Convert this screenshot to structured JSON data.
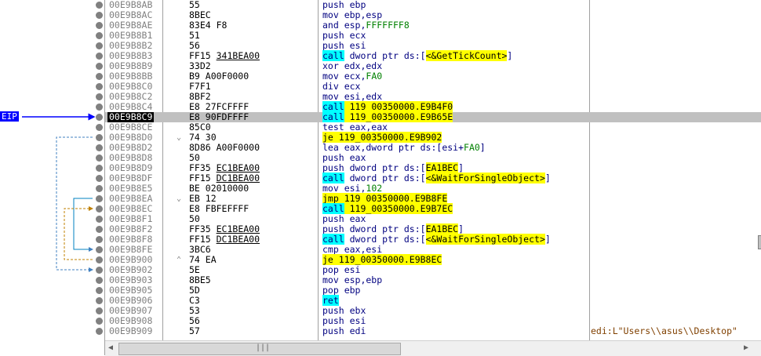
{
  "eip_label": "EIP",
  "colors": {
    "eip_bg": "#0000ff",
    "highlight_call": "#00ffff",
    "highlight_jump": "#ffff00"
  },
  "rows": [
    {
      "addr": "00E9B8AB",
      "arrow": "",
      "bytes": "55",
      "bytes_ul": "",
      "instr": [
        [
          "",
          "push ebp"
        ]
      ],
      "comment": ""
    },
    {
      "addr": "00E9B8AC",
      "arrow": "",
      "bytes": "8BEC",
      "bytes_ul": "",
      "instr": [
        [
          "",
          "mov ebp,esp"
        ]
      ],
      "comment": ""
    },
    {
      "addr": "00E9B8AE",
      "arrow": "",
      "bytes": "83E4 F8",
      "bytes_ul": "",
      "instr": [
        [
          "",
          "and esp,"
        ],
        [
          "num",
          "FFFFFFF8"
        ]
      ],
      "comment": ""
    },
    {
      "addr": "00E9B8B1",
      "arrow": "",
      "bytes": "51",
      "bytes_ul": "",
      "instr": [
        [
          "",
          "push ecx"
        ]
      ],
      "comment": ""
    },
    {
      "addr": "00E9B8B2",
      "arrow": "",
      "bytes": "56",
      "bytes_ul": "",
      "instr": [
        [
          "",
          "push esi"
        ]
      ],
      "comment": ""
    },
    {
      "addr": "00E9B8B3",
      "arrow": "",
      "bytes": "FF15 ",
      "bytes_ul": "341BEA00",
      "instr": [
        [
          "cyan",
          "call"
        ],
        [
          "",
          " dword ptr ds:["
        ],
        [
          "yellow",
          "<&GetTickCount>"
        ],
        [
          "",
          "]"
        ]
      ],
      "comment": ""
    },
    {
      "addr": "00E9B8B9",
      "arrow": "",
      "bytes": "33D2",
      "bytes_ul": "",
      "instr": [
        [
          "",
          "xor edx,edx"
        ]
      ],
      "comment": ""
    },
    {
      "addr": "00E9B8BB",
      "arrow": "",
      "bytes": "B9 A00F0000",
      "bytes_ul": "",
      "instr": [
        [
          "",
          "mov ecx,"
        ],
        [
          "num",
          "FA0"
        ]
      ],
      "comment": ""
    },
    {
      "addr": "00E9B8C0",
      "arrow": "",
      "bytes": "F7F1",
      "bytes_ul": "",
      "instr": [
        [
          "",
          "div ecx"
        ]
      ],
      "comment": ""
    },
    {
      "addr": "00E9B8C2",
      "arrow": "",
      "bytes": "8BF2",
      "bytes_ul": "",
      "instr": [
        [
          "",
          "mov esi,edx"
        ]
      ],
      "comment": ""
    },
    {
      "addr": "00E9B8C4",
      "arrow": "",
      "bytes": "E8 27FCFFFF",
      "bytes_ul": "",
      "instr": [
        [
          "cyan",
          "call"
        ],
        [
          "yellow",
          " 119_00350000.E9B4F0"
        ]
      ],
      "comment": ""
    },
    {
      "addr": "00E9B8C9",
      "arrow": "",
      "bytes": "E8 90FDFFFF",
      "bytes_ul": "",
      "instr": [
        [
          "cyan",
          "call"
        ],
        [
          "yellow",
          " 119_00350000.E9B65E"
        ]
      ],
      "comment": "",
      "eip": true
    },
    {
      "addr": "00E9B8CE",
      "arrow": "",
      "bytes": "85C0",
      "bytes_ul": "",
      "instr": [
        [
          "",
          "test eax,eax"
        ]
      ],
      "comment": ""
    },
    {
      "addr": "00E9B8D0",
      "arrow": "v",
      "bytes": "74 30",
      "bytes_ul": "",
      "instr": [
        [
          "yellow",
          "je"
        ],
        [
          "yellow",
          " 119_00350000.E9B902"
        ]
      ],
      "comment": ""
    },
    {
      "addr": "00E9B8D2",
      "arrow": "",
      "bytes": "8D86 A00F0000",
      "bytes_ul": "",
      "instr": [
        [
          "",
          "lea eax,dword ptr ds:[esi+"
        ],
        [
          "num",
          "FA0"
        ],
        [
          "",
          "]"
        ]
      ],
      "comment": ""
    },
    {
      "addr": "00E9B8D8",
      "arrow": "",
      "bytes": "50",
      "bytes_ul": "",
      "instr": [
        [
          "",
          "push eax"
        ]
      ],
      "comment": ""
    },
    {
      "addr": "00E9B8D9",
      "arrow": "",
      "bytes": "FF35 ",
      "bytes_ul": "EC1BEA00",
      "instr": [
        [
          "",
          "push dword ptr ds:["
        ],
        [
          "yellow",
          "EA1BEC"
        ],
        [
          "",
          "]"
        ]
      ],
      "comment": ""
    },
    {
      "addr": "00E9B8DF",
      "arrow": "",
      "bytes": "FF15 ",
      "bytes_ul": "DC1BEA00",
      "instr": [
        [
          "cyan",
          "call"
        ],
        [
          "",
          " dword ptr ds:["
        ],
        [
          "yellow",
          "<&WaitForSingleObject>"
        ],
        [
          "",
          "]"
        ]
      ],
      "comment": ""
    },
    {
      "addr": "00E9B8E5",
      "arrow": "",
      "bytes": "BE 02010000",
      "bytes_ul": "",
      "instr": [
        [
          "",
          "mov esi,"
        ],
        [
          "num",
          "102"
        ]
      ],
      "comment": ""
    },
    {
      "addr": "00E9B8EA",
      "arrow": "v",
      "bytes": "EB 12",
      "bytes_ul": "",
      "instr": [
        [
          "yellow",
          "jmp"
        ],
        [
          "yellow",
          " 119_00350000.E9B8FE"
        ]
      ],
      "comment": ""
    },
    {
      "addr": "00E9B8EC",
      "arrow": ">",
      "bytes": "E8 FBFEFFFF",
      "bytes_ul": "",
      "instr": [
        [
          "cyan",
          "call"
        ],
        [
          "yellow",
          " 119_00350000.E9B7EC"
        ]
      ],
      "comment": ""
    },
    {
      "addr": "00E9B8F1",
      "arrow": "",
      "bytes": "50",
      "bytes_ul": "",
      "instr": [
        [
          "",
          "push eax"
        ]
      ],
      "comment": ""
    },
    {
      "addr": "00E9B8F2",
      "arrow": "",
      "bytes": "FF35 ",
      "bytes_ul": "EC1BEA00",
      "instr": [
        [
          "",
          "push dword ptr ds:["
        ],
        [
          "yellow",
          "EA1BEC"
        ],
        [
          "",
          "]"
        ]
      ],
      "comment": ""
    },
    {
      "addr": "00E9B8F8",
      "arrow": "",
      "bytes": "FF15 ",
      "bytes_ul": "DC1BEA00",
      "instr": [
        [
          "cyan",
          "call"
        ],
        [
          "",
          " dword ptr ds:["
        ],
        [
          "yellow",
          "<&WaitForSingleObject>"
        ],
        [
          "",
          "]"
        ]
      ],
      "comment": ""
    },
    {
      "addr": "00E9B8FE",
      "arrow": ">",
      "bytes": "3BC6",
      "bytes_ul": "",
      "instr": [
        [
          "",
          "cmp eax,esi"
        ]
      ],
      "comment": ""
    },
    {
      "addr": "00E9B900",
      "arrow": "^",
      "bytes": "74 EA",
      "bytes_ul": "",
      "instr": [
        [
          "yellow",
          "je"
        ],
        [
          "yellow",
          " 119_00350000.E9B8EC"
        ]
      ],
      "comment": ""
    },
    {
      "addr": "00E9B902",
      "arrow": ">",
      "bytes": "5E",
      "bytes_ul": "",
      "instr": [
        [
          "",
          "pop esi"
        ]
      ],
      "comment": ""
    },
    {
      "addr": "00E9B903",
      "arrow": "",
      "bytes": "8BE5",
      "bytes_ul": "",
      "instr": [
        [
          "",
          "mov esp,ebp"
        ]
      ],
      "comment": ""
    },
    {
      "addr": "00E9B905",
      "arrow": "",
      "bytes": "5D",
      "bytes_ul": "",
      "instr": [
        [
          "",
          "pop ebp"
        ]
      ],
      "comment": ""
    },
    {
      "addr": "00E9B906",
      "arrow": "",
      "bytes": "C3",
      "bytes_ul": "",
      "instr": [
        [
          "cyan",
          "ret"
        ]
      ],
      "comment": ""
    },
    {
      "addr": "00E9B907",
      "arrow": "",
      "bytes": "53",
      "bytes_ul": "",
      "instr": [
        [
          "",
          "push ebx"
        ]
      ],
      "comment": ""
    },
    {
      "addr": "00E9B908",
      "arrow": "",
      "bytes": "56",
      "bytes_ul": "",
      "instr": [
        [
          "",
          "push esi"
        ]
      ],
      "comment": ""
    },
    {
      "addr": "00E9B909",
      "arrow": "",
      "bytes": "57",
      "bytes_ul": "",
      "instr": [
        [
          "",
          "push edi"
        ]
      ],
      "comment": "edi:L\"Users\\\\asus\\\\Desktop\""
    }
  ],
  "scrollbar": {
    "left_icon": "arrow-left-icon",
    "right_icon": "arrow-right-icon",
    "grip": "|||"
  }
}
